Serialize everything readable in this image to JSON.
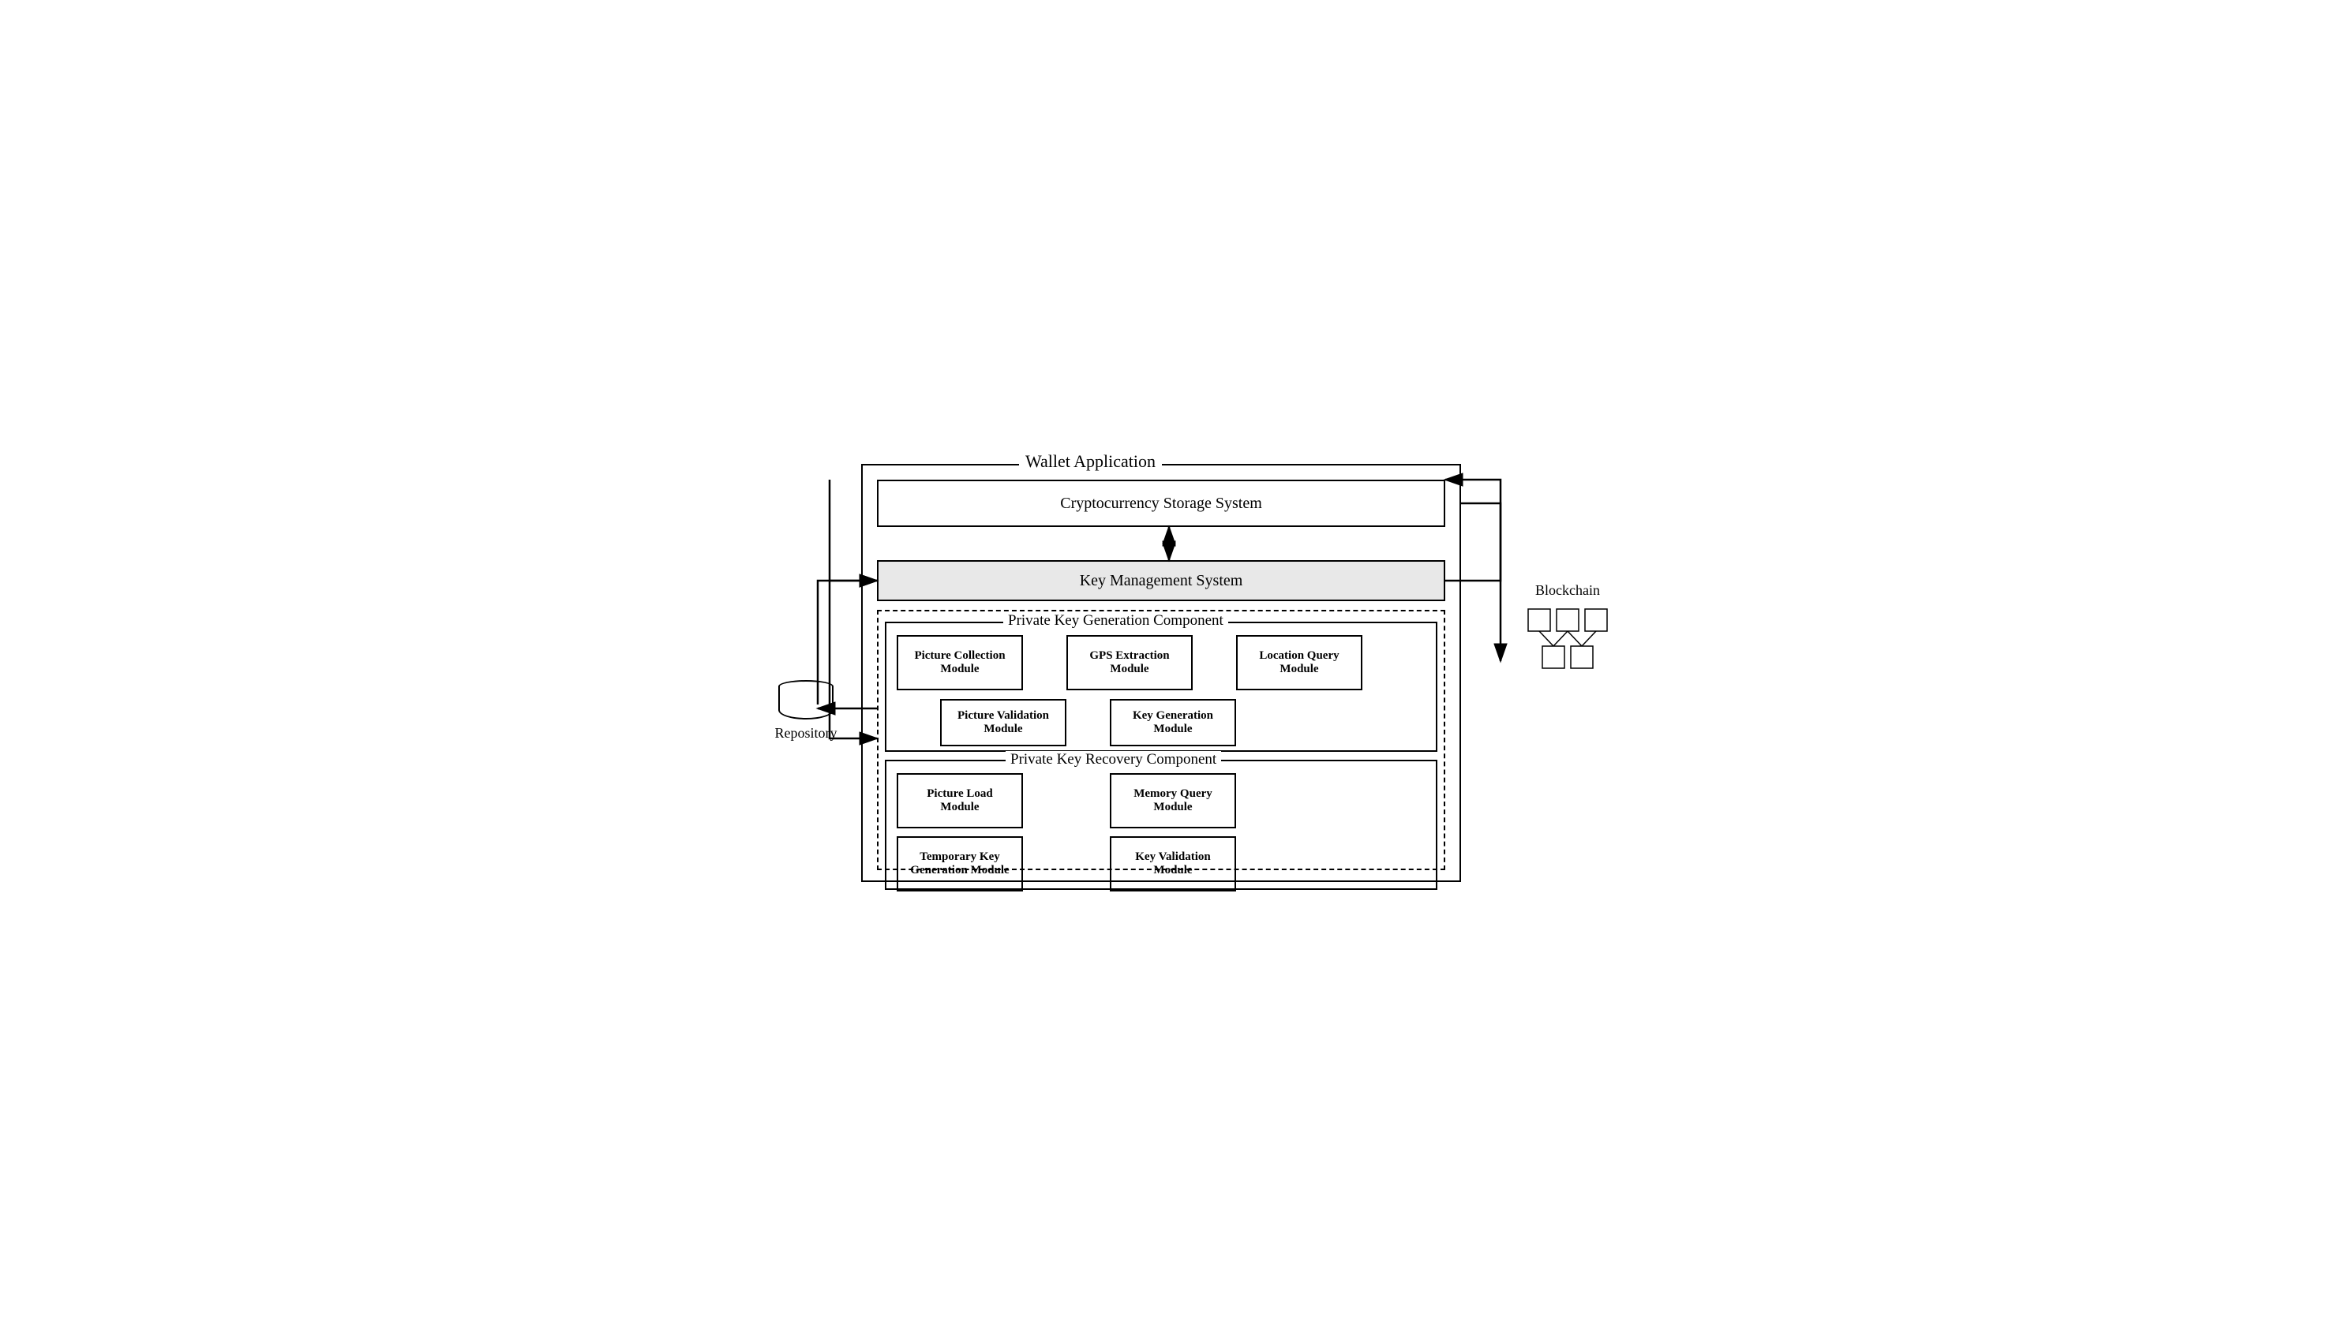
{
  "diagram": {
    "title": "Wallet Application",
    "crypto_storage": "Cryptocurrency Storage System",
    "kms": "Key Management System",
    "pkg": {
      "label": "Private Key Generation Component",
      "modules": {
        "picture_collection": "Picture Collection\nModule",
        "gps_extraction": "GPS Extraction\nModule",
        "location_query": "Location Query\nModule",
        "picture_validation": "Picture Validation\nModule",
        "key_generation": "Key Generation\nModule"
      }
    },
    "pkr": {
      "label": "Private Key Recovery Component",
      "modules": {
        "picture_load": "Picture Load\nModule",
        "memory_query": "Memory Query\nModule",
        "temp_key_gen": "Temporary Key\nGeneration Module",
        "key_validation": "Key Validation\nModule"
      }
    },
    "repository": "Repository",
    "blockchain": "Blockchain"
  }
}
